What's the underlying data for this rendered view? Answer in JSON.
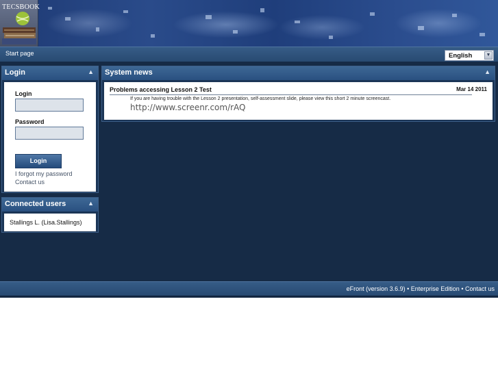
{
  "header": {
    "logo_text": "TECSBOOK"
  },
  "nav": {
    "start_page": "Start page",
    "language": "English",
    "language_arrow_icon": "chevron-down-icon"
  },
  "login_panel": {
    "title": "Login",
    "collapse_icon": "chevron-up-icon",
    "login_label": "Login",
    "login_value": "",
    "password_label": "Password",
    "password_value": "",
    "submit_label": "Login",
    "forgot_link": "I forgot my password",
    "contact_link": "Contact us"
  },
  "users_panel": {
    "title": "Connected users",
    "collapse_icon": "chevron-up-icon",
    "users": [
      "Stallings L. (Lisa.Stallings)"
    ]
  },
  "news_panel": {
    "title": "System news",
    "collapse_icon": "chevron-up-icon",
    "items": [
      {
        "title": "Problems accessing Lesson 2 Test",
        "date": "Mar 14 2011",
        "text": "If you are having trouble with the Lesson 2 presentation, self-assessment slide, please view this short 2 minute screencast.",
        "url": "http://www.screenr.com/rAQ"
      }
    ]
  },
  "footer": {
    "version": "eFront (version 3.6.9)",
    "separator": " • ",
    "edition": "Enterprise Edition",
    "contact": "Contact us"
  },
  "colors": {
    "background": "#162b46",
    "bar": "#2f5580",
    "panel_header": "#325c8a",
    "button": "#244b7b"
  }
}
